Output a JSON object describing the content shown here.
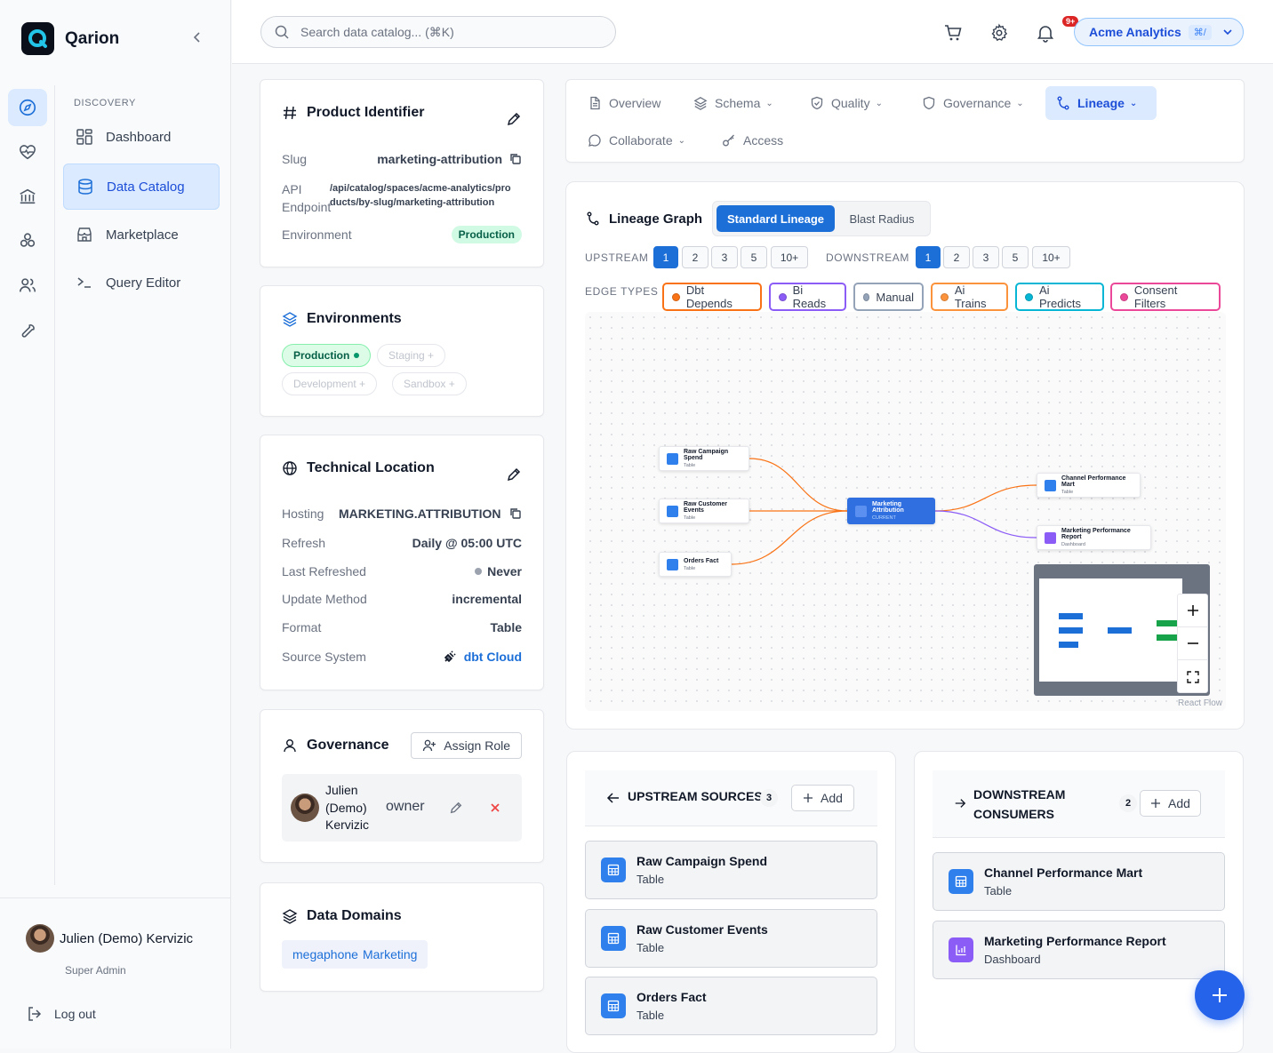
{
  "app": {
    "name": "Qarion"
  },
  "sidebar": {
    "section": "DISCOVERY",
    "items": [
      {
        "label": "Dashboard"
      },
      {
        "label": "Data Catalog"
      },
      {
        "label": "Marketplace"
      },
      {
        "label": "Query Editor"
      }
    ],
    "user": {
      "name": "Julien (Demo) Kervizic",
      "role": "Super Admin"
    },
    "logout": "Log out"
  },
  "topbar": {
    "search_placeholder": "Search data catalog... (⌘K)",
    "notifications_badge": "9+",
    "org": {
      "name": "Acme Analytics",
      "shortcut": "⌘/"
    }
  },
  "product": {
    "title": "Product Identifier",
    "slug_label": "Slug",
    "slug": "marketing-attribution",
    "api_label": "API Endpoint",
    "api_line1": "/api/catalog/spaces/acme-analytics/pro",
    "api_line2": "ducts/by-slug/marketing-attribution",
    "env_label": "Environment",
    "env": "Production"
  },
  "environments": {
    "title": "Environments",
    "active": "Production",
    "others": [
      "Staging +",
      "Development +",
      "Sandbox +"
    ]
  },
  "technical": {
    "title": "Technical Location",
    "rows": [
      {
        "k": "Hosting",
        "v": "MARKETING.ATTRIBUTION"
      },
      {
        "k": "Refresh",
        "v": "Daily @ 05:00 UTC"
      },
      {
        "k": "Last Refreshed",
        "v": "Never"
      },
      {
        "k": "Update Method",
        "v": "incremental"
      },
      {
        "k": "Format",
        "v": "Table"
      },
      {
        "k": "Source System",
        "v": "dbt Cloud"
      }
    ]
  },
  "governance": {
    "title": "Governance",
    "assign": "Assign Role",
    "member": {
      "name": "Julien (Demo) Kervizic",
      "role": "owner"
    }
  },
  "domains": {
    "title": "Data Domains",
    "icon_text": "megaphone",
    "domain": "Marketing"
  },
  "tabs": {
    "overview": "Overview",
    "schema": "Schema",
    "quality": "Quality",
    "governance": "Governance",
    "lineage": "Lineage",
    "collaborate": "Collaborate",
    "access": "Access"
  },
  "lineage": {
    "title": "Lineage Graph",
    "mode_standard": "Standard Lineage",
    "mode_blast": "Blast Radius",
    "upstream_label": "UPSTREAM",
    "downstream_label": "DOWNSTREAM",
    "levels": [
      "1",
      "2",
      "3",
      "5",
      "10+"
    ],
    "upstream_selected": "1",
    "downstream_selected": "1",
    "edge_types_label": "EDGE TYPES",
    "edge_types": [
      {
        "label": "Dbt Depends",
        "color": "#f97316"
      },
      {
        "label": "Bi Reads",
        "color": "#8b5cf6"
      },
      {
        "label": "Manual",
        "color": "#94a3b8"
      },
      {
        "label": "Ai Trains",
        "color": "#fb923c"
      },
      {
        "label": "Ai Predicts",
        "color": "#06b6d4"
      },
      {
        "label": "Consent Filters",
        "color": "#ec4899"
      }
    ],
    "nodes": {
      "raw_campaign": {
        "title": "Raw Campaign Spend",
        "sub": "Table"
      },
      "raw_customer": {
        "title": "Raw Customer Events",
        "sub": "Table"
      },
      "orders": {
        "title": "Orders Fact",
        "sub": "Table"
      },
      "current": {
        "title": "Marketing Attribution",
        "sub": "CURRENT"
      },
      "channel": {
        "title": "Channel Performance Mart",
        "sub": "Table"
      },
      "report": {
        "title": "Marketing Performance Report",
        "sub": "Dashboard"
      }
    },
    "attribution": "React Flow"
  },
  "upstream": {
    "title": "UPSTREAM SOURCES",
    "count": "3",
    "add": "Add",
    "items": [
      {
        "title": "Raw Campaign Spend",
        "sub": "Table"
      },
      {
        "title": "Raw Customer Events",
        "sub": "Table"
      },
      {
        "title": "Orders Fact",
        "sub": "Table"
      }
    ]
  },
  "downstream": {
    "title_line1": "DOWNSTREAM",
    "title_line2": "CONSUMERS",
    "count": "2",
    "add": "Add",
    "items": [
      {
        "title": "Channel Performance Mart",
        "sub": "Table"
      },
      {
        "title": "Marketing Performance Report",
        "sub": "Dashboard"
      }
    ]
  }
}
